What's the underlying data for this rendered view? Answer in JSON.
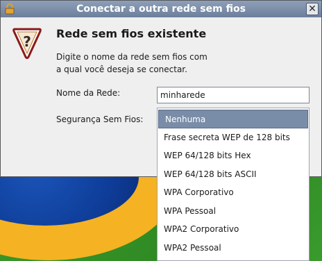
{
  "window": {
    "title": "Conectar a outra rede sem fios"
  },
  "dialog": {
    "heading": "Rede sem fios existente",
    "description_line1": "Digite o nome da rede sem fios com",
    "description_line2": "a qual você deseja se conectar.",
    "network_name_label": "Nome da Rede:",
    "network_name_value": "minharede",
    "security_label": "Segurança Sem Fios:"
  },
  "security_dropdown": {
    "selected": "Nenhuma",
    "options": [
      "Nenhuma",
      "Frase secreta WEP de 128 bits",
      "WEP 64/128 bits Hex",
      "WEP 64/128 bits ASCII",
      "WPA Corporativo",
      "WPA Pessoal",
      "WPA2 Corporativo",
      "WPA2 Pessoal"
    ]
  },
  "icons": {
    "title_icon": "lock-icon",
    "close_icon": "close-icon",
    "dialog_icon": "question-icon"
  }
}
